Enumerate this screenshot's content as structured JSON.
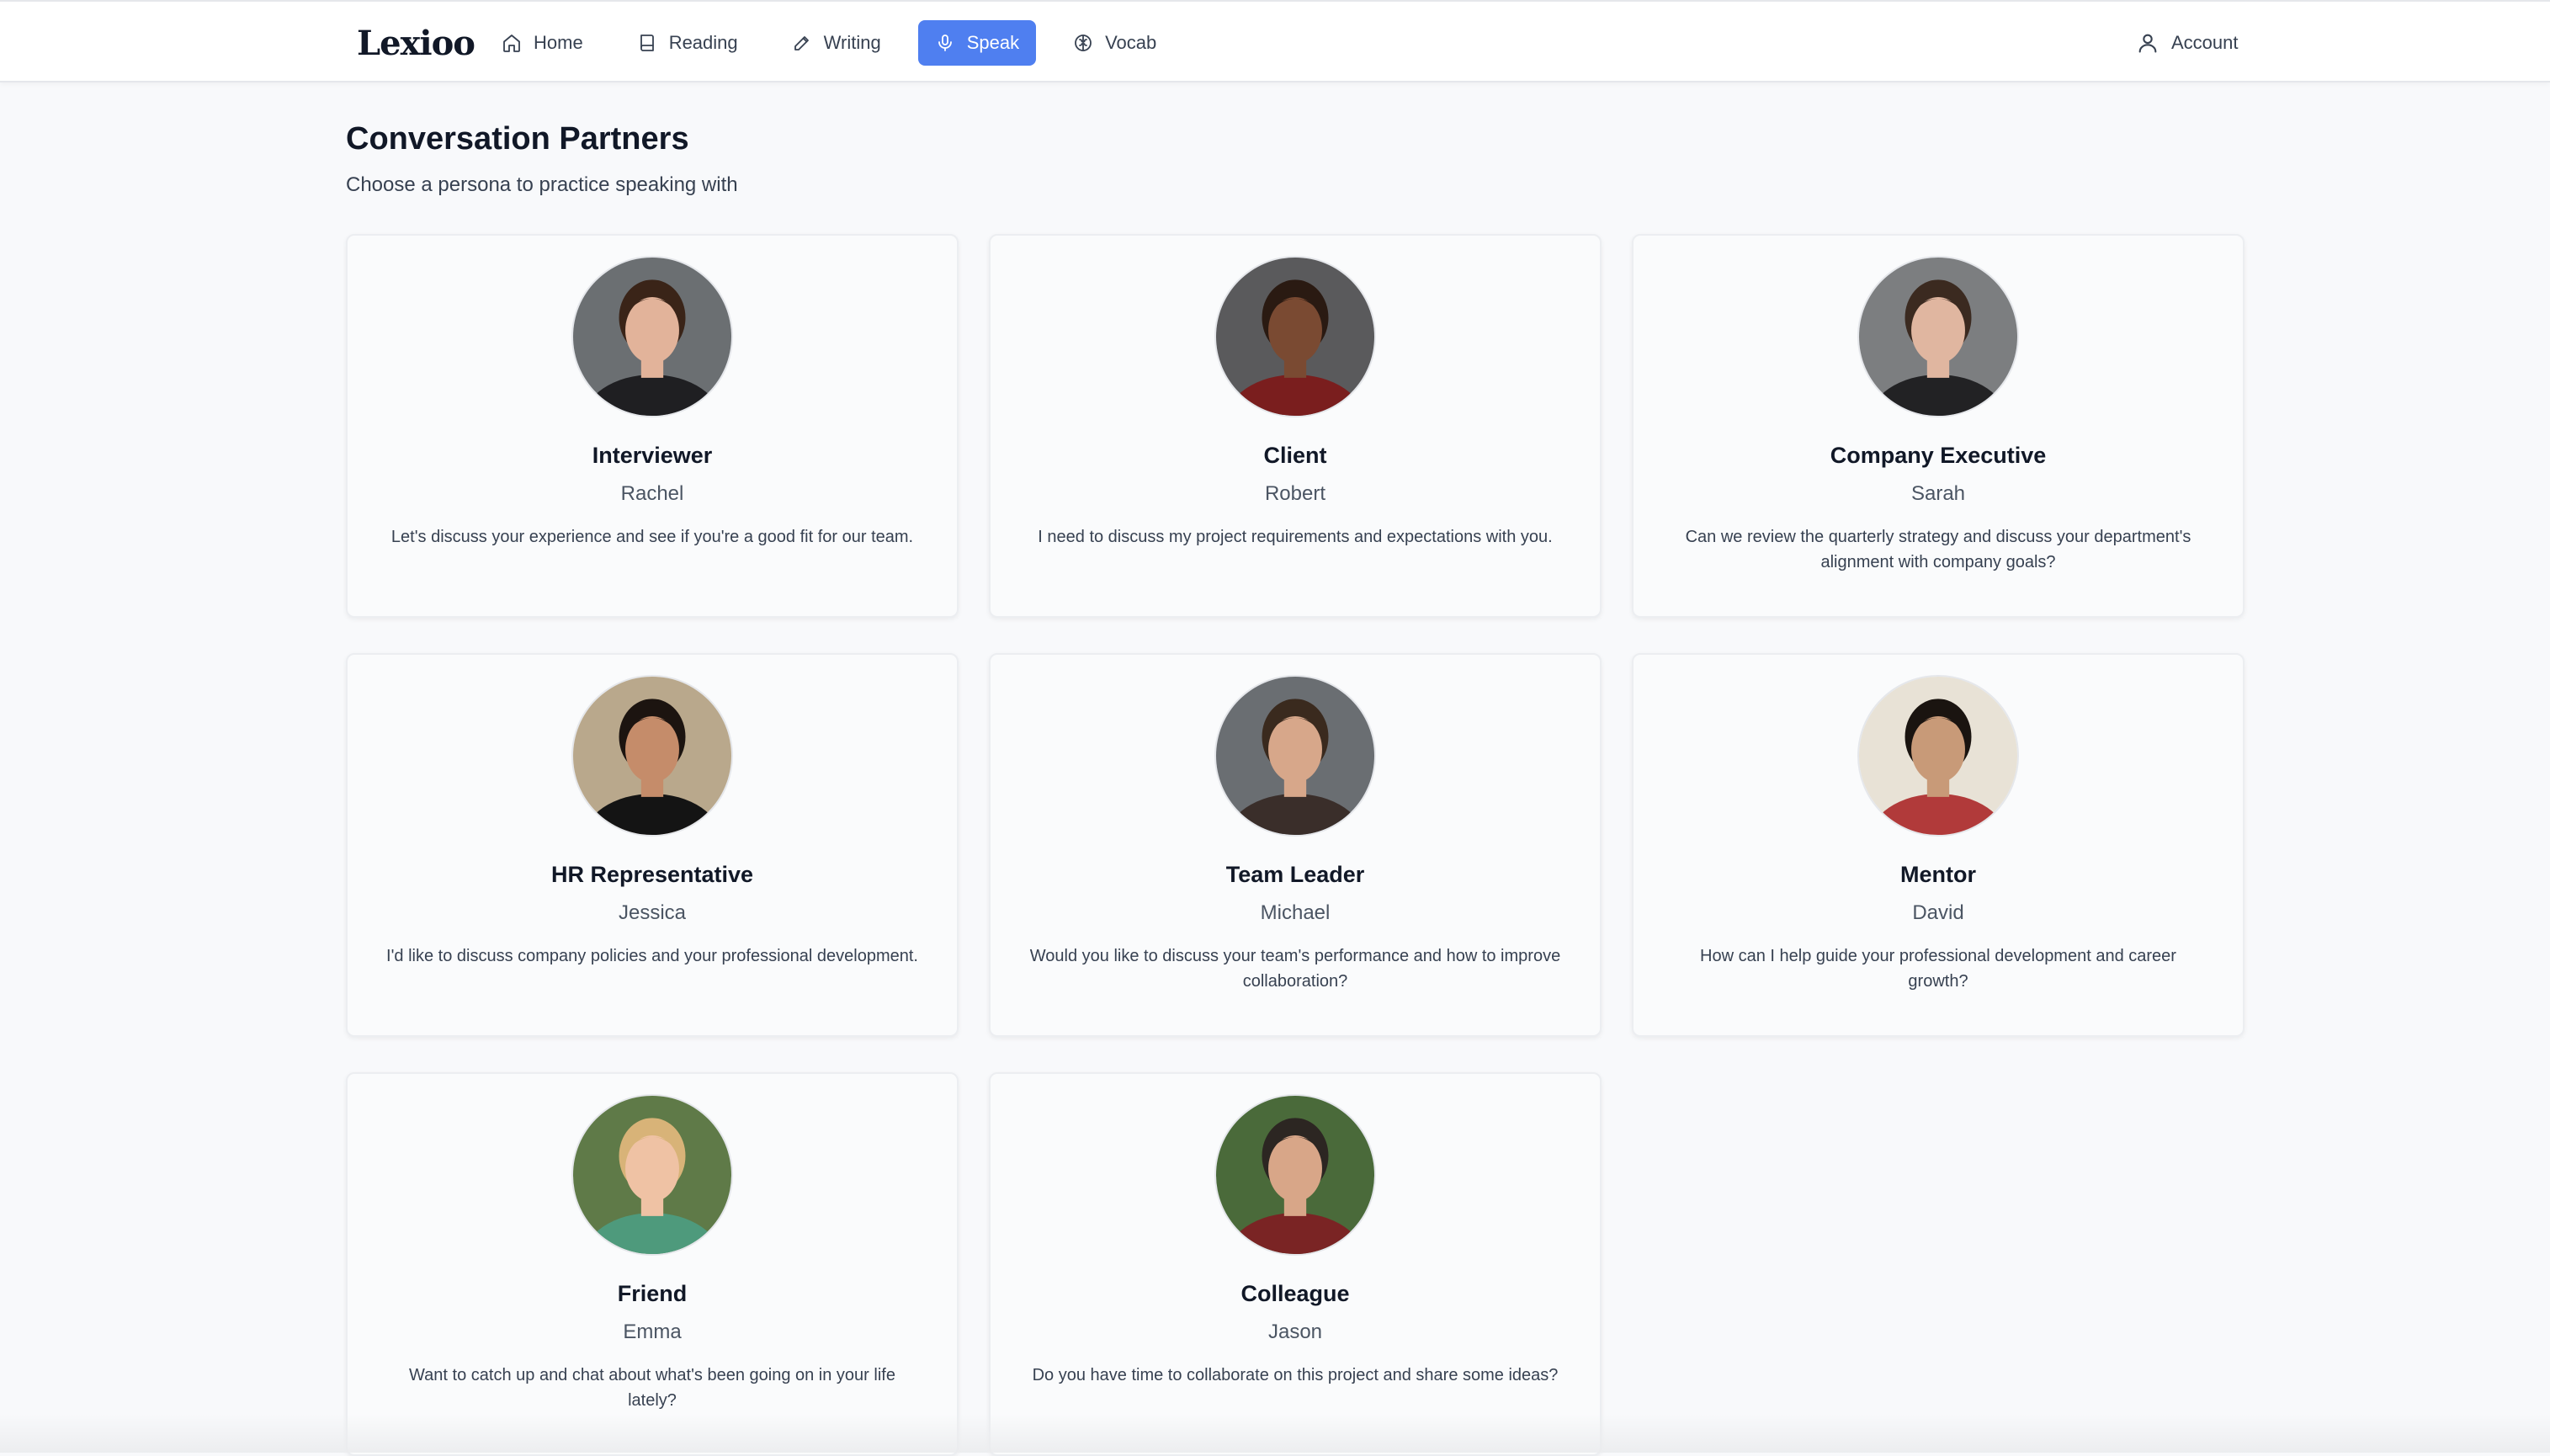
{
  "app": {
    "logo": "Lexioo"
  },
  "nav": {
    "items": [
      {
        "label": "Home",
        "icon": "home-icon",
        "active": false
      },
      {
        "label": "Reading",
        "icon": "book-icon",
        "active": false
      },
      {
        "label": "Writing",
        "icon": "pencil-icon",
        "active": false
      },
      {
        "label": "Speak",
        "icon": "microphone-icon",
        "active": true
      },
      {
        "label": "Vocab",
        "icon": "brain-icon",
        "active": false
      }
    ],
    "account_label": "Account"
  },
  "page": {
    "title": "Conversation Partners",
    "subtitle": "Choose a persona to practice speaking with"
  },
  "personas": [
    {
      "role": "Interviewer",
      "name": "Rachel",
      "greeting": "Let's discuss your experience and see if you're a good fit for our team.",
      "avatar": {
        "bg": "#6b6f72",
        "skin": "#e2b39a",
        "hair": "#3a2418",
        "shirt": "#1f1f22"
      }
    },
    {
      "role": "Client",
      "name": "Robert",
      "greeting": "I need to discuss my project requirements and expectations with you.",
      "avatar": {
        "bg": "#5a5a5c",
        "skin": "#7a4a32",
        "hair": "#2a1a12",
        "shirt": "#7a1e1e"
      }
    },
    {
      "role": "Company Executive",
      "name": "Sarah",
      "greeting": "Can we review the quarterly strategy and discuss your department's alignment with company goals?",
      "avatar": {
        "bg": "#7c7e80",
        "skin": "#e0b6a0",
        "hair": "#3b2a20",
        "shirt": "#222224"
      }
    },
    {
      "role": "HR Representative",
      "name": "Jessica",
      "greeting": "I'd like to discuss company policies and your professional development.",
      "avatar": {
        "bg": "#b9a88c",
        "skin": "#c58c6a",
        "hair": "#1c1410",
        "shirt": "#141414"
      }
    },
    {
      "role": "Team Leader",
      "name": "Michael",
      "greeting": "Would you like to discuss your team's performance and how to improve collaboration?",
      "avatar": {
        "bg": "#6a6e72",
        "skin": "#d7a78a",
        "hair": "#3a2a1e",
        "shirt": "#3a2e2a"
      }
    },
    {
      "role": "Mentor",
      "name": "David",
      "greeting": "How can I help guide your professional development and career growth?",
      "avatar": {
        "bg": "#e8e2d6",
        "skin": "#c89a78",
        "hair": "#1a1410",
        "shirt": "#b13a3a"
      }
    },
    {
      "role": "Friend",
      "name": "Emma",
      "greeting": "Want to catch up and chat about what's been going on in your life lately?",
      "avatar": {
        "bg": "#5f7a48",
        "skin": "#efc2a4",
        "hair": "#d8b378",
        "shirt": "#4e9a7c"
      }
    },
    {
      "role": "Colleague",
      "name": "Jason",
      "greeting": "Do you have time to collaborate on this project and share some ideas?",
      "avatar": {
        "bg": "#4a6a3a",
        "skin": "#d8a688",
        "hair": "#2c2622",
        "shirt": "#7a2424"
      }
    }
  ],
  "colors": {
    "accent": "#4f7ff0",
    "background": "#f8f9fb"
  }
}
